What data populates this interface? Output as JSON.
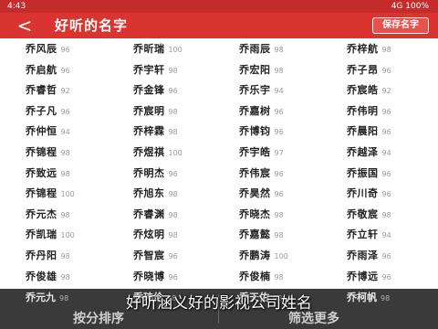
{
  "status_bar": {
    "left_text": "4:43",
    "right_text": "4G 100%"
  },
  "nav": {
    "back_glyph": "<",
    "title": "好听的名字",
    "action_label": "保存名字"
  },
  "names": [
    [
      {
        "name": "乔风辰",
        "score": "96"
      },
      {
        "name": "乔昕瑞",
        "score": "100"
      },
      {
        "name": "乔雨辰",
        "score": "98"
      },
      {
        "name": "乔梓航",
        "score": "98"
      }
    ],
    [
      {
        "name": "乔启航",
        "score": "96"
      },
      {
        "name": "乔宇轩",
        "score": "98"
      },
      {
        "name": "乔宏阳",
        "score": "98"
      },
      {
        "name": "乔子昂",
        "score": "96"
      }
    ],
    [
      {
        "name": "乔睿哲",
        "score": "92"
      },
      {
        "name": "乔金锋",
        "score": "96"
      },
      {
        "name": "乔乐宇",
        "score": "94"
      },
      {
        "name": "乔宸皓",
        "score": "92"
      }
    ],
    [
      {
        "name": "乔子凡",
        "score": "96"
      },
      {
        "name": "乔宸明",
        "score": "98"
      },
      {
        "name": "乔嘉树",
        "score": "96"
      },
      {
        "name": "乔伟明",
        "score": "96"
      }
    ],
    [
      {
        "name": "乔仲恒",
        "score": "94"
      },
      {
        "name": "乔梓霖",
        "score": "98"
      },
      {
        "name": "乔博钧",
        "score": "96"
      },
      {
        "name": "乔晨阳",
        "score": "96"
      }
    ],
    [
      {
        "name": "乔锦程",
        "score": "98"
      },
      {
        "name": "乔煜祺",
        "score": "100"
      },
      {
        "name": "乔宇皓",
        "score": "97"
      },
      {
        "name": "乔越泽",
        "score": "94"
      }
    ],
    [
      {
        "name": "乔致远",
        "score": "98"
      },
      {
        "name": "乔明杰",
        "score": "96"
      },
      {
        "name": "乔伟宸",
        "score": "96"
      },
      {
        "name": "乔振国",
        "score": "96"
      }
    ],
    [
      {
        "name": "乔锦程",
        "score": "100"
      },
      {
        "name": "乔旭东",
        "score": "98"
      },
      {
        "name": "乔昊然",
        "score": "96"
      },
      {
        "name": "乔川奇",
        "score": "96"
      }
    ],
    [
      {
        "name": "乔元杰",
        "score": "98"
      },
      {
        "name": "乔睿渊",
        "score": "98"
      },
      {
        "name": "乔晓杰",
        "score": "98"
      },
      {
        "name": "乔敬宸",
        "score": "98"
      }
    ],
    [
      {
        "name": "乔凯瑞",
        "score": "100"
      },
      {
        "name": "乔炫明",
        "score": "98"
      },
      {
        "name": "乔嘉懿",
        "score": "98"
      },
      {
        "name": "乔立轩",
        "score": "94"
      }
    ],
    [
      {
        "name": "乔丹阳",
        "score": "98"
      },
      {
        "name": "乔智宸",
        "score": "96"
      },
      {
        "name": "乔鹏涛",
        "score": "100"
      },
      {
        "name": "乔雨泽",
        "score": "96"
      }
    ],
    [
      {
        "name": "乔俊雄",
        "score": "98"
      },
      {
        "name": "乔晓博",
        "score": "96"
      },
      {
        "name": "乔俊楠",
        "score": "98"
      },
      {
        "name": "乔博远",
        "score": "96"
      }
    ],
    [
      {
        "name": "乔元九",
        "score": "98"
      },
      {
        "name": "乔玮伦",
        "score": "98"
      },
      {
        "name": "乔天佑",
        "score": "98"
      },
      {
        "name": "乔柯帆",
        "score": "98"
      }
    ]
  ],
  "bottom": {
    "sort_label": "按分排序",
    "more_label": "筛选更多"
  },
  "subtitle": "好听涵义好的影视公司姓名"
}
